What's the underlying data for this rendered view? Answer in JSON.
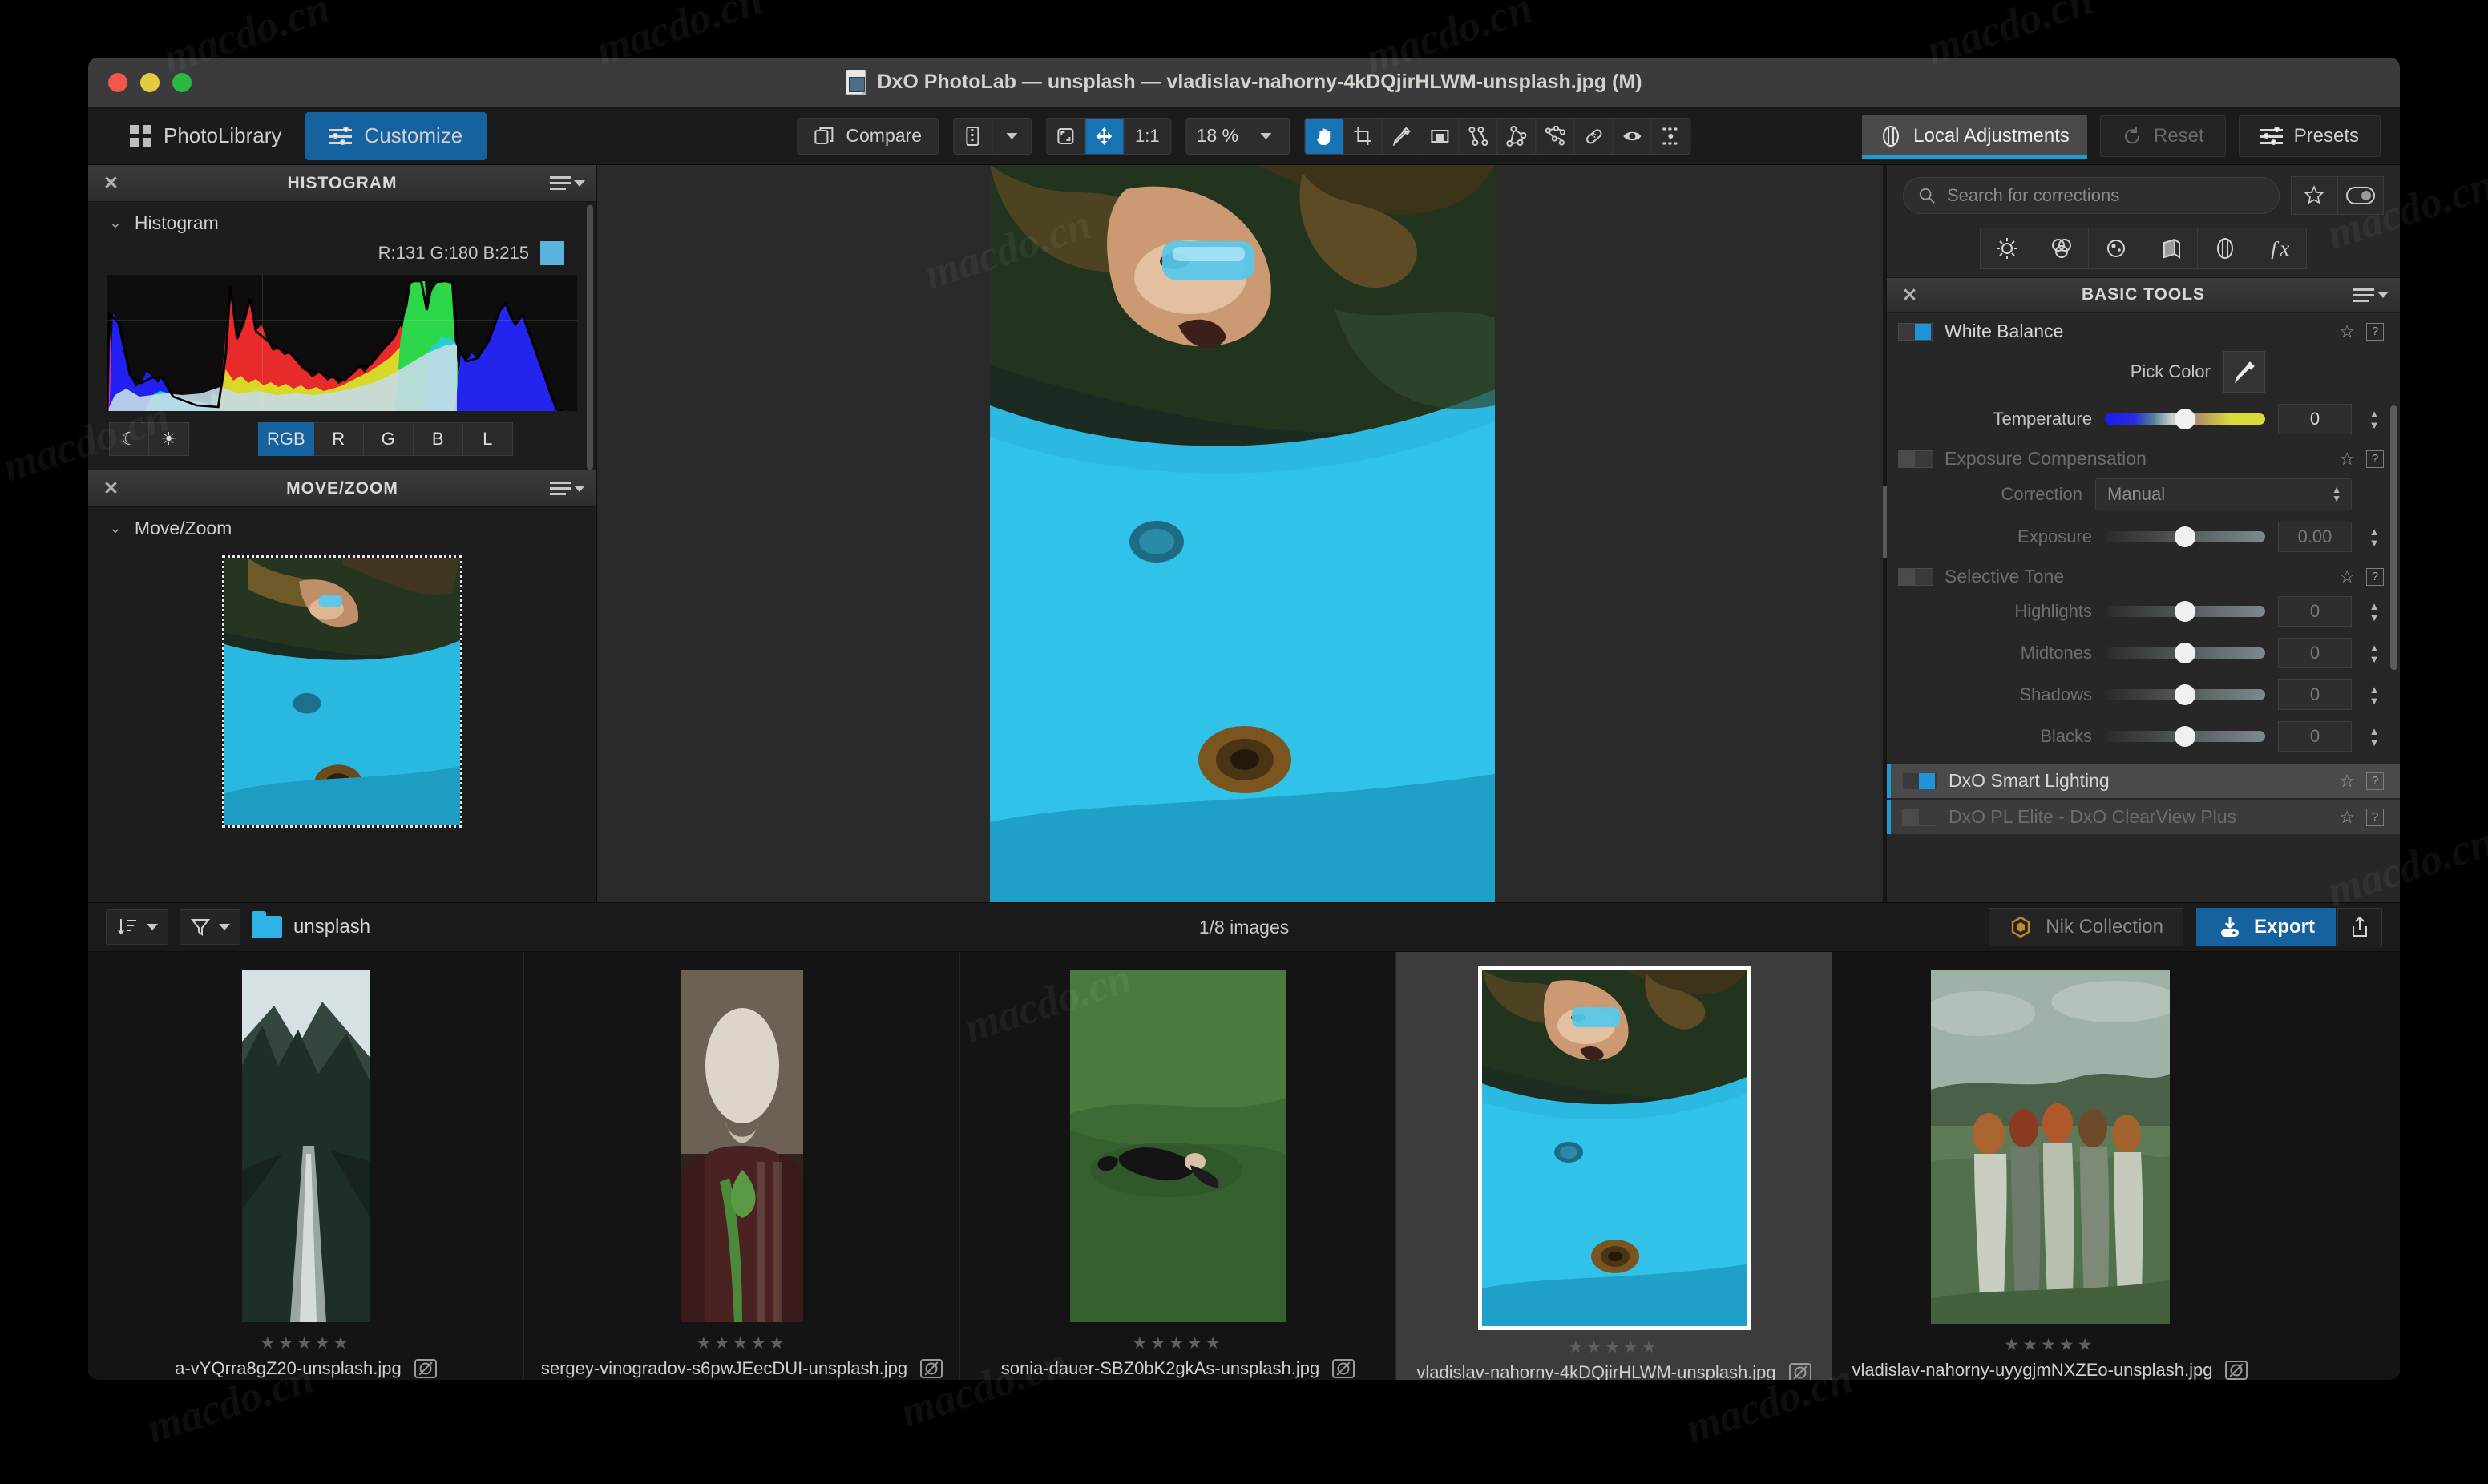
{
  "window": {
    "title": "DxO PhotoLab — unsplash — vladislav-nahorny-4kDQjirHLWM-unsplash.jpg (M)"
  },
  "toolbar": {
    "photolibrary_label": "PhotoLibrary",
    "customize_label": "Customize",
    "compare_label": "Compare",
    "ratio_label": "1:1",
    "zoom_value": "18 %",
    "local_adjustments_label": "Local Adjustments",
    "reset_label": "Reset",
    "presets_label": "Presets"
  },
  "left_panel": {
    "histogram": {
      "header": "HISTOGRAM",
      "section_title": "Histogram",
      "rgb_readout": "R:131 G:180 B:215",
      "swatch_color": "#5cb3dd",
      "channels": [
        "RGB",
        "R",
        "G",
        "B",
        "L"
      ],
      "active_channel": "RGB",
      "shadow_icon": "moon-icon",
      "highlight_icon": "sun-icon"
    },
    "move_zoom": {
      "header": "MOVE/ZOOM",
      "section_title": "Move/Zoom"
    }
  },
  "right_panel": {
    "search": {
      "placeholder": "Search for corrections"
    },
    "tool_tabs": [
      "light-icon",
      "color-icon",
      "detail-icon",
      "geometry-icon",
      "local-adjust-icon",
      "fx-icon"
    ],
    "basic_tools": {
      "header": "BASIC TOOLS",
      "groups": [
        {
          "name": "White Balance",
          "enabled": true,
          "dim": false,
          "pick_color_label": "Pick Color",
          "rows": [
            {
              "label": "Temperature",
              "value": "0",
              "track": "temp"
            }
          ]
        },
        {
          "name": "Exposure Compensation",
          "enabled": false,
          "dim": true,
          "correction_label": "Correction",
          "correction_value": "Manual",
          "rows": [
            {
              "label": "Exposure",
              "value": "0.00",
              "track": "gray"
            }
          ]
        },
        {
          "name": "Selective Tone",
          "enabled": false,
          "dim": true,
          "rows": [
            {
              "label": "Highlights",
              "value": "0",
              "track": "gray"
            },
            {
              "label": "Midtones",
              "value": "0",
              "track": "gray"
            },
            {
              "label": "Shadows",
              "value": "0",
              "track": "gray"
            },
            {
              "label": "Blacks",
              "value": "0",
              "track": "gray"
            }
          ]
        }
      ],
      "collapsed_rows": [
        {
          "name": "DxO Smart Lighting",
          "enabled": true,
          "dim": false
        },
        {
          "name": "DxO PL Elite - DxO ClearView Plus",
          "enabled": false,
          "dim": true
        }
      ]
    }
  },
  "filmstrip_bar": {
    "folder_name": "unsplash",
    "image_count": "1/8 images",
    "nik_label": "Nik Collection",
    "export_label": "Export"
  },
  "thumbnails": [
    {
      "filename": "a-vYQrra8gZ20-unsplash.jpg",
      "stars": "★★★★★",
      "selected": false
    },
    {
      "filename": "sergey-vinogradov-s6pwJEecDUI-unsplash.jpg",
      "stars": "★★★★★",
      "selected": false
    },
    {
      "filename": "sonia-dauer-SBZ0bK2gkAs-unsplash.jpg",
      "stars": "★★★★★",
      "selected": false
    },
    {
      "filename": "vladislav-nahorny-4kDQjirHLWM-unsplash.jpg",
      "stars": "★★★★★",
      "selected": true
    },
    {
      "filename": "vladislav-nahorny-uyygjmNXZEo-unsplash.jpg",
      "stars": "★★★★★",
      "selected": false
    }
  ],
  "watermarks": [
    "macdo.cn",
    "macdo.cn",
    "macdo.cn",
    "macdo.cn",
    "macdo.cn",
    "macdo.cn",
    "macdo.cn",
    "macdo.cn",
    "macdo.cn",
    "macdo.cn",
    "macdo.cn",
    "macdo.cn"
  ],
  "colors": {
    "accent_blue": "#15629f",
    "highlight_blue": "#1e9bd7",
    "panel_bg": "#272727",
    "window_bg": "#1e1e1e"
  }
}
